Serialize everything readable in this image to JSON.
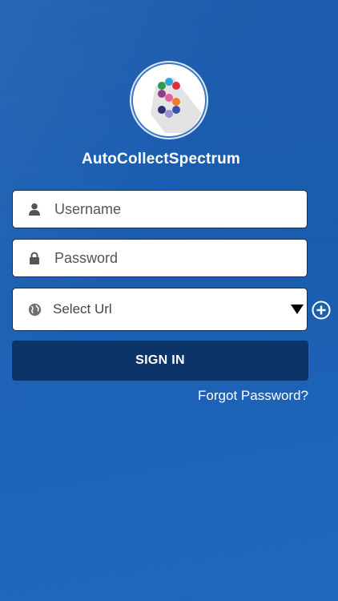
{
  "app": {
    "title": "AutoCollectSpectrum"
  },
  "login": {
    "username_placeholder": "Username",
    "password_placeholder": "Password",
    "url_select_value": "Select Url",
    "signin_label": "SIGN IN",
    "forgot_label": "Forgot Password?"
  },
  "icons": {
    "user": "user-icon",
    "lock": "lock-icon",
    "globe": "globe-icon",
    "dropdown": "caret-down-icon",
    "add": "plus-circle-icon"
  },
  "colors": {
    "background": "#1a5fb4",
    "signin_button": "#0d3468",
    "field_border": "#1b2e4f",
    "text_light": "#ffffff"
  }
}
